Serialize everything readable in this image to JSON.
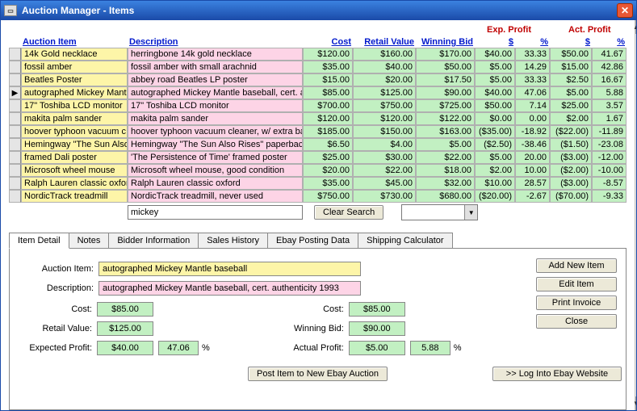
{
  "window": {
    "title": "Auction Manager - Items"
  },
  "headers": {
    "item": "Auction Item",
    "desc": "Description",
    "cost": "Cost",
    "retail": "Retail Value",
    "winbid": "Winning Bid",
    "exp_profit": "Exp. Profit",
    "act_profit": "Act. Profit",
    "dollars": "$",
    "percent": "%"
  },
  "rows": [
    {
      "item": "14k Gold necklace",
      "desc": "herringbone 14k gold necklace",
      "cost": "$120.00",
      "retail": "$160.00",
      "winbid": "$170.00",
      "expd": "$40.00",
      "expp": "33.33",
      "actd": "$50.00",
      "actp": "41.67"
    },
    {
      "item": "fossil amber",
      "desc": "fossil amber with small arachnid",
      "cost": "$35.00",
      "retail": "$40.00",
      "winbid": "$50.00",
      "expd": "$5.00",
      "expp": "14.29",
      "actd": "$15.00",
      "actp": "42.86"
    },
    {
      "item": "Beatles Poster",
      "desc": "abbey road Beatles LP poster",
      "cost": "$15.00",
      "retail": "$20.00",
      "winbid": "$17.50",
      "expd": "$5.00",
      "expp": "33.33",
      "actd": "$2.50",
      "actp": "16.67"
    },
    {
      "item": "autographed Mickey Mantl",
      "desc": "autographed Mickey Mantle baseball, cert. aut",
      "cost": "$85.00",
      "retail": "$125.00",
      "winbid": "$90.00",
      "expd": "$40.00",
      "expp": "47.06",
      "actd": "$5.00",
      "actp": "5.88",
      "selected": true
    },
    {
      "item": "17\" Toshiba LCD monitor",
      "desc": "17\" Toshiba LCD monitor",
      "cost": "$700.00",
      "retail": "$750.00",
      "winbid": "$725.00",
      "expd": "$50.00",
      "expp": "7.14",
      "actd": "$25.00",
      "actp": "3.57"
    },
    {
      "item": "makita palm sander",
      "desc": "makita palm sander",
      "cost": "$120.00",
      "retail": "$120.00",
      "winbid": "$122.00",
      "expd": "$0.00",
      "expp": "0.00",
      "actd": "$2.00",
      "actp": "1.67"
    },
    {
      "item": "hoover typhoon vacuum c",
      "desc": "hoover typhoon vacuum cleaner, w/ extra bag",
      "cost": "$185.00",
      "retail": "$150.00",
      "winbid": "$163.00",
      "expd": "($35.00)",
      "expp": "-18.92",
      "actd": "($22.00)",
      "actp": "-11.89"
    },
    {
      "item": "Hemingway \"The Sun Also",
      "desc": "Hemingway \"The Sun Also Rises\" paperback, g",
      "cost": "$6.50",
      "retail": "$4.00",
      "winbid": "$5.00",
      "expd": "($2.50)",
      "expp": "-38.46",
      "actd": "($1.50)",
      "actp": "-23.08"
    },
    {
      "item": "framed Dali poster",
      "desc": "'The Persistence of Time' framed poster",
      "cost": "$25.00",
      "retail": "$30.00",
      "winbid": "$22.00",
      "expd": "$5.00",
      "expp": "20.00",
      "actd": "($3.00)",
      "actp": "-12.00"
    },
    {
      "item": "Microsoft wheel mouse",
      "desc": "Microsoft wheel mouse, good condition",
      "cost": "$20.00",
      "retail": "$22.00",
      "winbid": "$18.00",
      "expd": "$2.00",
      "expp": "10.00",
      "actd": "($2.00)",
      "actp": "-10.00"
    },
    {
      "item": "Ralph Lauren classic oxfor",
      "desc": "Ralph Lauren classic oxford",
      "cost": "$35.00",
      "retail": "$45.00",
      "winbid": "$32.00",
      "expd": "$10.00",
      "expp": "28.57",
      "actd": "($3.00)",
      "actp": "-8.57"
    },
    {
      "item": "NordicTrack treadmill",
      "desc": "NordicTrack treadmill, never used",
      "cost": "$750.00",
      "retail": "$730.00",
      "winbid": "$680.00",
      "expd": "($20.00)",
      "expp": "-2.67",
      "actd": "($70.00)",
      "actp": "-9.33"
    }
  ],
  "search": {
    "value": "mickey",
    "clear_label": "Clear Search"
  },
  "tabs": [
    "Item Detail",
    "Notes",
    "Bidder Information",
    "Sales History",
    "Ebay Posting Data",
    "Shipping Calculator"
  ],
  "detail": {
    "labels": {
      "item": "Auction Item:",
      "desc": "Description:",
      "cost": "Cost:",
      "retail": "Retail Value:",
      "exp_profit": "Expected Profit:",
      "cost2": "Cost:",
      "winbid": "Winning Bid:",
      "act_profit": "Actual Profit:",
      "percent": "%"
    },
    "item": "autographed Mickey Mantle baseball",
    "desc": "autographed Mickey Mantle baseball, cert. authenticity 1993",
    "cost": "$85.00",
    "retail": "$125.00",
    "exp_profit": "$40.00",
    "exp_pct": "47.06",
    "cost2": "$85.00",
    "winbid": "$90.00",
    "act_profit": "$5.00",
    "act_pct": "5.88",
    "post_label": "Post Item to New Ebay Auction"
  },
  "buttons": {
    "add": "Add New Item",
    "edit": "Edit Item",
    "print": "Print Invoice",
    "close": "Close",
    "ebay": ">> Log Into Ebay Website"
  }
}
